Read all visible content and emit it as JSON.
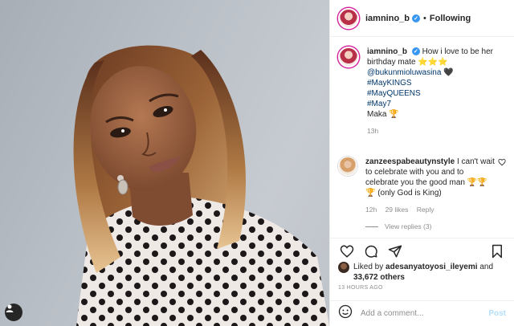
{
  "header": {
    "username": "iamnino_b",
    "separator": "•",
    "following_label": "Following"
  },
  "caption": {
    "username": "iamnino_b",
    "text_1": "How i love to be her birthday mate ⭐⭐⭐",
    "mention": "@bukunmioluwasina",
    "heart": "🖤",
    "hashtags": [
      "#MayKINGS",
      "#MayQUEENS",
      "#May7"
    ],
    "signoff": "Maka 🏆",
    "time": "13h"
  },
  "comment": {
    "username": "zanzeespabeautynstyle",
    "text": "I can't wait to celebrate with you and to celebrate you the good man 🏆🏆🏆 (only God is King)",
    "time": "12h",
    "likes": "29 likes",
    "reply_label": "Reply",
    "view_replies": "View replies (3)"
  },
  "likes": {
    "prefix": "Liked by",
    "user": "adesanyatoyosi_ileyemi",
    "joiner": "and",
    "count": "33,672 others"
  },
  "posted_ago": "13 HOURS AGO",
  "add_comment": {
    "placeholder": "Add a comment...",
    "post_label": "Post"
  },
  "icons": [
    "heart-icon",
    "comment-icon",
    "share-icon",
    "bookmark-icon",
    "emoji-icon",
    "verified-icon",
    "profile-icon"
  ],
  "colors": {
    "link": "#00376b",
    "verified": "#3897f0",
    "muted": "#8e8e8e",
    "post_disabled": "#b2dffc"
  }
}
